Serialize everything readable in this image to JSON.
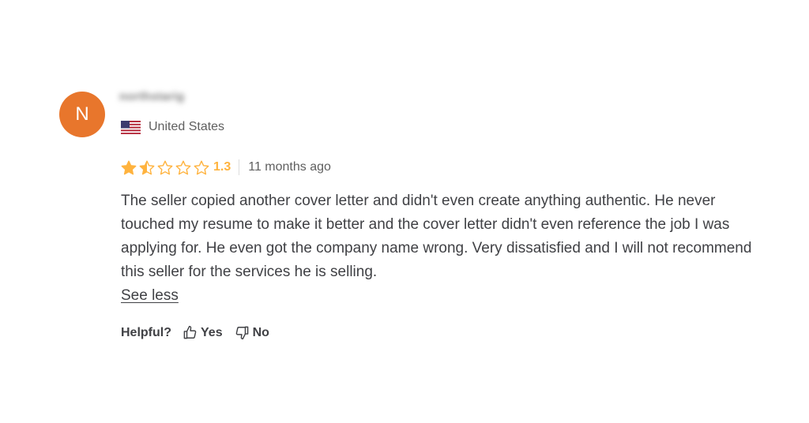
{
  "review": {
    "avatar_letter": "N",
    "username": "northstarig",
    "country": "United States",
    "rating": {
      "score_text": "1.3",
      "value": 1.3,
      "max": 5,
      "stars": [
        "full",
        "half",
        "empty",
        "empty",
        "empty"
      ]
    },
    "time_ago": "11 months ago",
    "text": "The seller copied another cover letter and didn't even create anything authentic. He never touched my resume to make it better and the cover letter didn't even reference the job I was applying for. He even got the company name wrong. Very dissatisfied and I will not recommend this seller for the services he is selling.",
    "see_less_label": "See less",
    "helpful": {
      "label": "Helpful?",
      "yes_label": "Yes",
      "no_label": "No"
    }
  },
  "colors": {
    "avatar_bg": "#e8762c",
    "star": "#ffb33e",
    "star_empty": "#ffb33e",
    "text": "#404145",
    "muted": "#5f5f5f"
  },
  "icons": {
    "flag": "us-flag-icon",
    "star": "star-icon",
    "thumbs_up": "thumbs-up-icon",
    "thumbs_down": "thumbs-down-icon"
  }
}
